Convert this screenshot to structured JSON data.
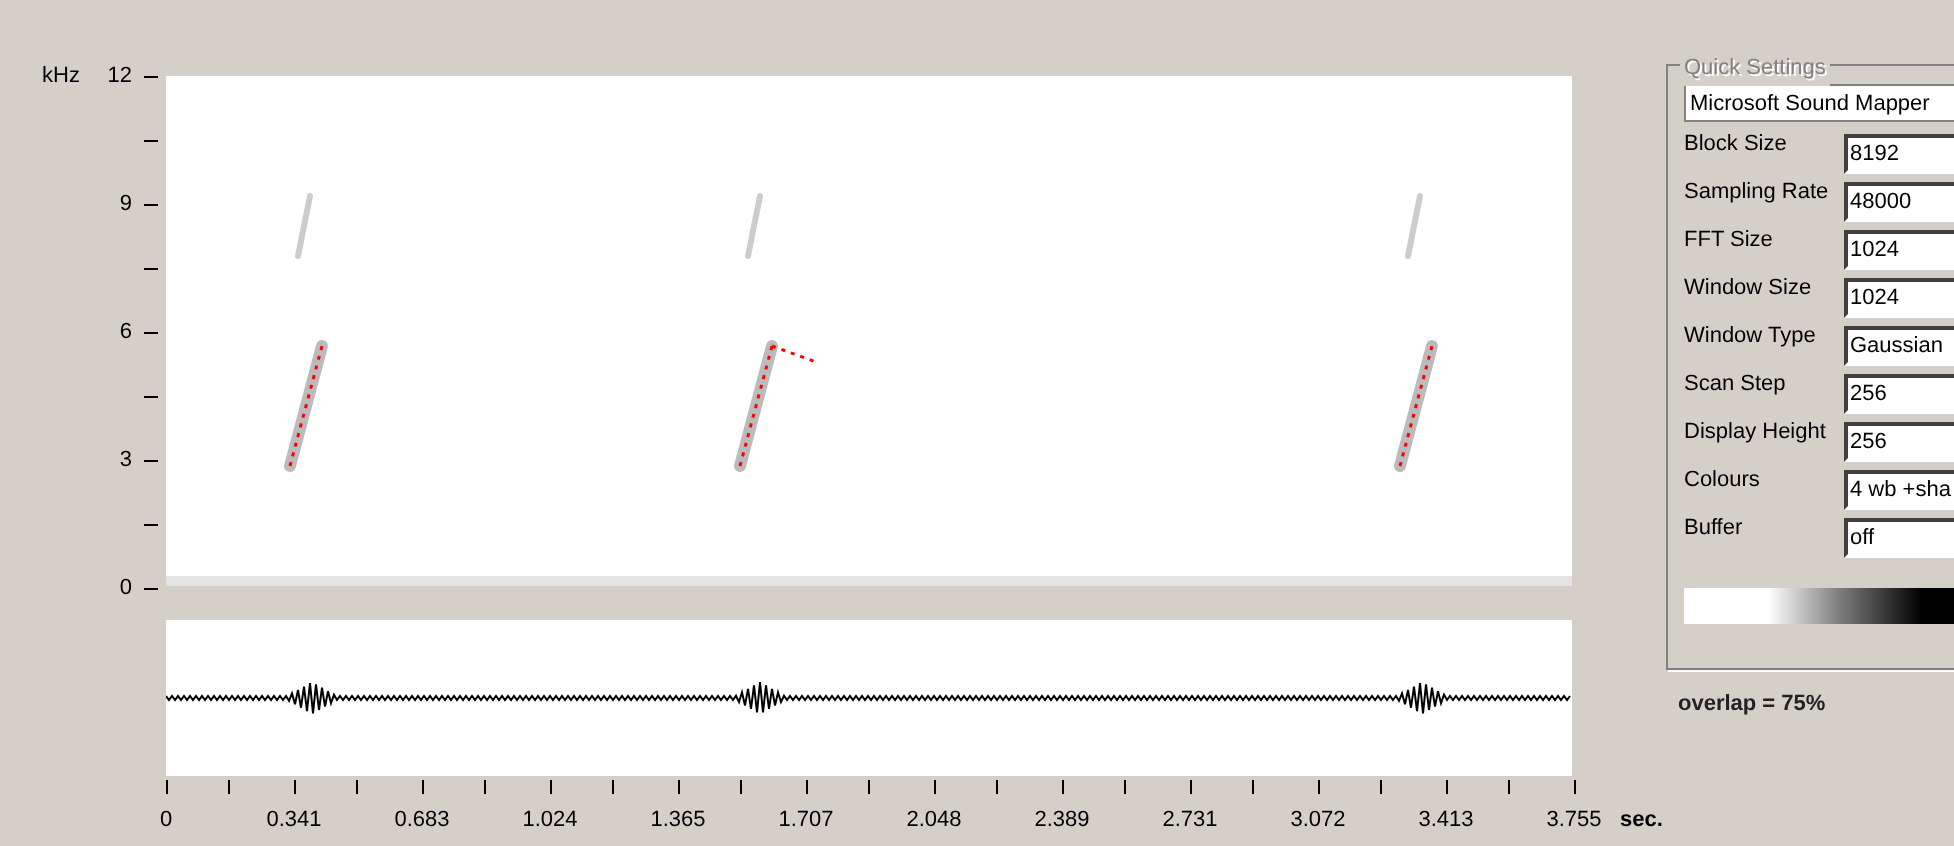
{
  "frequency_axis": {
    "unit": "kHz",
    "labels": [
      "12",
      "9",
      "6",
      "3",
      "0"
    ]
  },
  "time_axis": {
    "labels": [
      "0",
      "0.341",
      "0.683",
      "1.024",
      "1.365",
      "1.707",
      "2.048",
      "2.389",
      "2.731",
      "3.072",
      "3.413",
      "3.755"
    ],
    "unit": "sec."
  },
  "quick_settings": {
    "title": "Quick Settings",
    "device": "Microsoft Sound Mapper",
    "fields": [
      {
        "label": "Block Size",
        "value": "8192"
      },
      {
        "label": "Sampling Rate",
        "value": "48000"
      },
      {
        "label": "FFT Size",
        "value": "1024"
      },
      {
        "label": "Window Size",
        "value": "1024"
      },
      {
        "label": "Window Type",
        "value": "Gaussian"
      },
      {
        "label": "Scan Step",
        "value": "256"
      },
      {
        "label": "Display Height",
        "value": "256"
      },
      {
        "label": "Colours",
        "value": "4 wb +sha"
      },
      {
        "label": "Buffer",
        "value": "off"
      }
    ]
  },
  "overlap": "overlap = 75%"
}
